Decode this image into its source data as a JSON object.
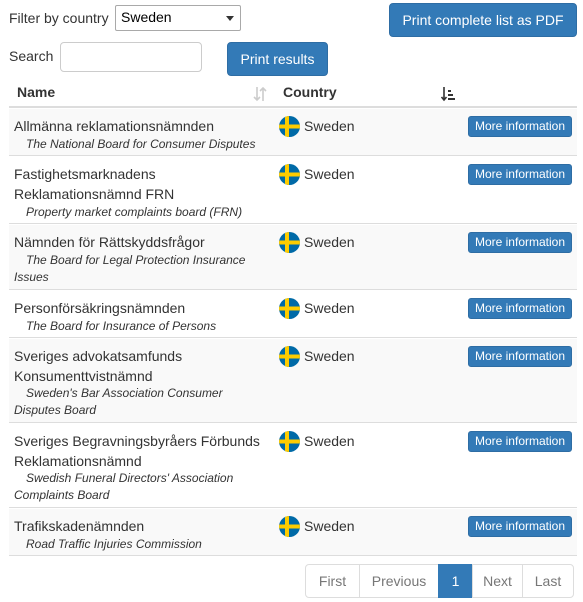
{
  "filter": {
    "label": "Filter by country",
    "selected": "Sweden"
  },
  "search": {
    "label": "Search",
    "value": "",
    "placeholder": ""
  },
  "buttons": {
    "print_pdf": "Print complete list as PDF",
    "print_results": "Print results"
  },
  "table": {
    "headers": {
      "name": "Name",
      "country": "Country"
    },
    "rows": [
      {
        "name": "Allmänna reklamationsnämnden",
        "subtitle": "The National Board for Consumer Disputes",
        "country": "Sweden",
        "action": "More information"
      },
      {
        "name": "Fastighetsmarknadens Reklamationsnämnd FRN",
        "subtitle": "Property market complaints board (FRN)",
        "country": "Sweden",
        "action": "More information"
      },
      {
        "name": "Nämnden för Rättskyddsfrågor",
        "subtitle": "The Board for Legal Protection Insurance Issues",
        "country": "Sweden",
        "action": "More information"
      },
      {
        "name": "Personförsäkringsnämnden",
        "subtitle": "The Board for Insurance of Persons",
        "country": "Sweden",
        "action": "More information"
      },
      {
        "name": "Sveriges advokatsamfunds Konsumenttvistnämnd",
        "subtitle": "Sweden's Bar Association Consumer Disputes Board",
        "country": "Sweden",
        "action": "More information"
      },
      {
        "name": "Sveriges Begravningsbyråers Förbunds Reklamationsnämnd",
        "subtitle": "Swedish Funeral Directors' Association Complaints Board",
        "country": "Sweden",
        "action": "More information"
      },
      {
        "name": "Trafikskadenämnden",
        "subtitle": "Road Traffic Injuries Commission",
        "country": "Sweden",
        "action": "More information"
      }
    ]
  },
  "pagination": {
    "first": "First",
    "previous": "Previous",
    "current": "1",
    "next": "Next",
    "last": "Last"
  },
  "colors": {
    "primary": "#337ab7",
    "flag_blue": "#006aa7",
    "flag_yellow": "#fecc00"
  }
}
